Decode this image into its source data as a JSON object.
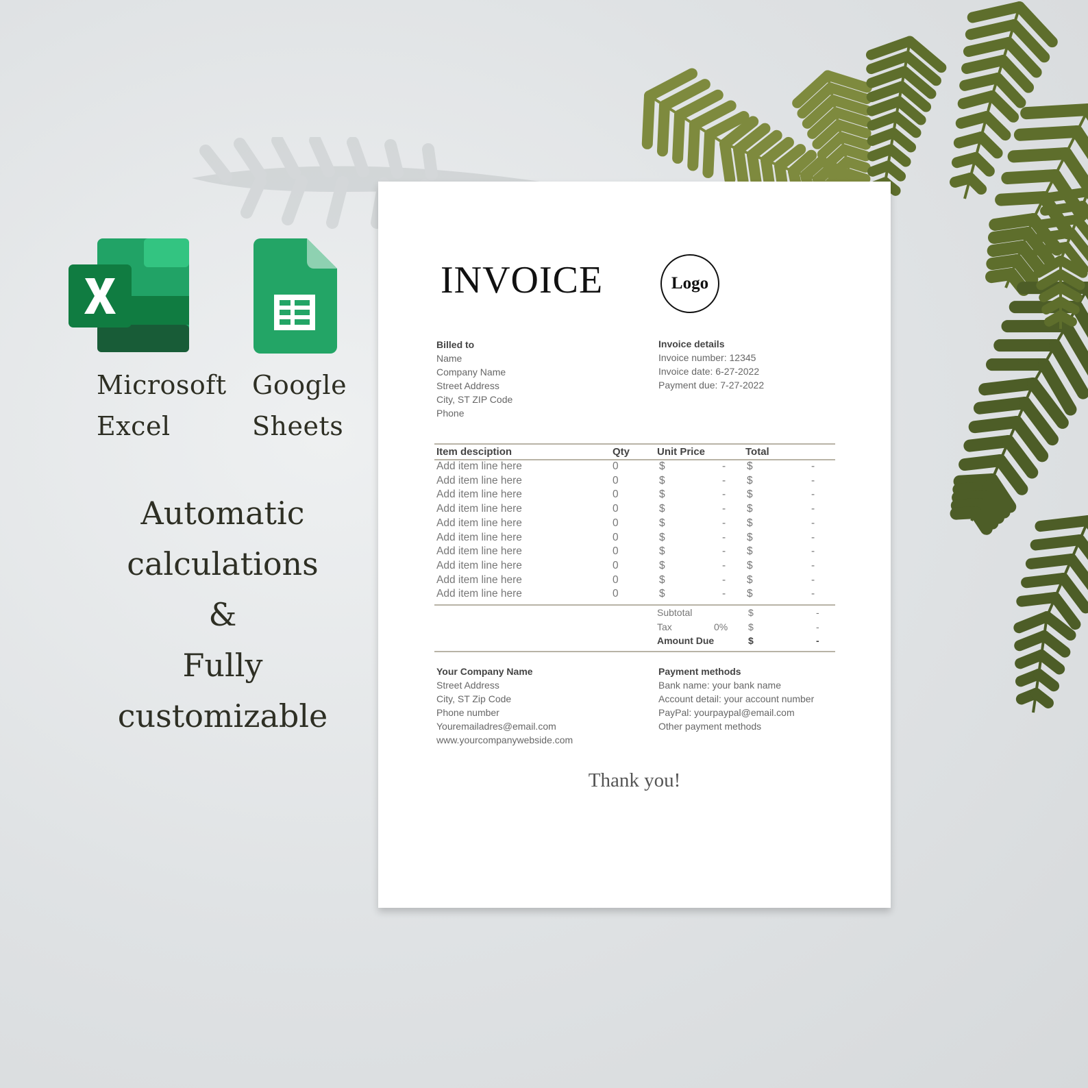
{
  "apps": [
    {
      "name": "Microsoft\nExcel",
      "icon": "excel-icon"
    },
    {
      "name": "Google\nSheets",
      "icon": "google-sheets-icon"
    }
  ],
  "tagline": [
    "Automatic",
    "calculations",
    "&",
    "Fully",
    "customizable"
  ],
  "invoice": {
    "title": "INVOICE",
    "logo": "Logo",
    "billed_to": {
      "heading": "Billed to",
      "lines": [
        "Name",
        "Company Name",
        "Street Address",
        "City, ST ZIP Code",
        "Phone"
      ]
    },
    "details": {
      "heading": "Invoice details",
      "lines": [
        "Invoice number: 12345",
        "Invoice date: 6-27-2022",
        "Payment due: 7-27-2022"
      ]
    },
    "columns": [
      "Item desciption",
      "Qty",
      "Unit Price",
      "Total"
    ],
    "items": [
      {
        "desc": "Add item line here",
        "qty": "0",
        "cur1": "$",
        "price": "-",
        "cur2": "$",
        "total": "-"
      },
      {
        "desc": "Add item line here",
        "qty": "0",
        "cur1": "$",
        "price": "-",
        "cur2": "$",
        "total": "-"
      },
      {
        "desc": "Add item line here",
        "qty": "0",
        "cur1": "$",
        "price": "-",
        "cur2": "$",
        "total": "-"
      },
      {
        "desc": "Add item line here",
        "qty": "0",
        "cur1": "$",
        "price": "-",
        "cur2": "$",
        "total": "-"
      },
      {
        "desc": "Add item line here",
        "qty": "0",
        "cur1": "$",
        "price": "-",
        "cur2": "$",
        "total": "-"
      },
      {
        "desc": "Add item line here",
        "qty": "0",
        "cur1": "$",
        "price": "-",
        "cur2": "$",
        "total": "-"
      },
      {
        "desc": "Add item line here",
        "qty": "0",
        "cur1": "$",
        "price": "-",
        "cur2": "$",
        "total": "-"
      },
      {
        "desc": "Add item line here",
        "qty": "0",
        "cur1": "$",
        "price": "-",
        "cur2": "$",
        "total": "-"
      },
      {
        "desc": "Add item line here",
        "qty": "0",
        "cur1": "$",
        "price": "-",
        "cur2": "$",
        "total": "-"
      },
      {
        "desc": "Add item line here",
        "qty": "0",
        "cur1": "$",
        "price": "-",
        "cur2": "$",
        "total": "-"
      }
    ],
    "totals": [
      {
        "label": "Subtotal",
        "rate": "",
        "cur": "$",
        "value": "-",
        "bold": false
      },
      {
        "label": "Tax",
        "rate": "0%",
        "cur": "$",
        "value": "-",
        "bold": false
      },
      {
        "label": "Amount Due",
        "rate": "",
        "cur": "$",
        "value": "-",
        "bold": true
      }
    ],
    "company": {
      "heading": "Your Company Name",
      "lines": [
        "Street Address",
        "City, ST  Zip Code",
        "Phone number",
        "Youremailadres@email.com",
        "www.yourcompanywebside.com"
      ]
    },
    "payment": {
      "heading": "Payment methods",
      "lines": [
        "Bank name: your bank name",
        "Account detail: your account number",
        "PayPal: yourpaypal@email.com",
        "Other payment methods"
      ]
    },
    "thanks": "Thank you!"
  }
}
